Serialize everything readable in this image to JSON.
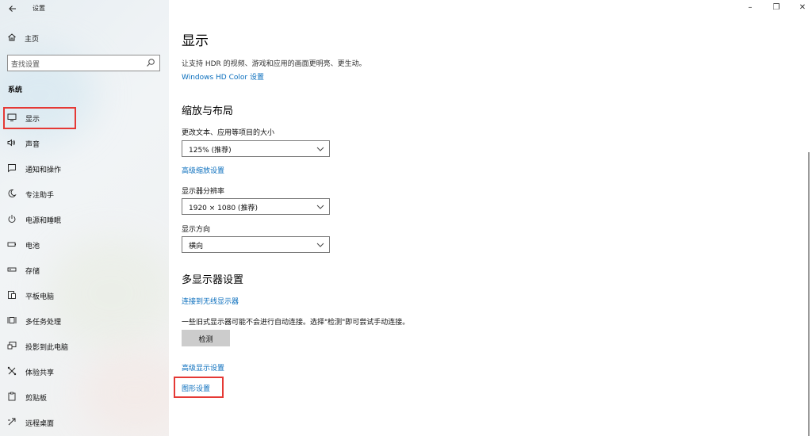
{
  "app": {
    "title": "设置"
  },
  "window_controls": {
    "minimize": "–",
    "restore": "❐",
    "close": "✕"
  },
  "sidebar": {
    "home_label": "主页",
    "search_placeholder": "查找设置",
    "section_label": "系统",
    "items": [
      {
        "label": "显示",
        "icon": "monitor-icon"
      },
      {
        "label": "声音",
        "icon": "speaker-icon"
      },
      {
        "label": "通知和操作",
        "icon": "notification-icon"
      },
      {
        "label": "专注助手",
        "icon": "moon-icon"
      },
      {
        "label": "电源和睡眠",
        "icon": "power-icon"
      },
      {
        "label": "电池",
        "icon": "battery-icon"
      },
      {
        "label": "存储",
        "icon": "storage-icon"
      },
      {
        "label": "平板电脑",
        "icon": "tablet-icon"
      },
      {
        "label": "多任务处理",
        "icon": "multitask-icon"
      },
      {
        "label": "投影到此电脑",
        "icon": "project-icon"
      },
      {
        "label": "体验共享",
        "icon": "share-icon"
      },
      {
        "label": "剪贴板",
        "icon": "clipboard-icon"
      },
      {
        "label": "远程桌面",
        "icon": "remote-desktop-icon"
      }
    ]
  },
  "main": {
    "title": "显示",
    "hdr_desc": "让支持 HDR 的视频、游戏和应用的画面更明亮、更生动。",
    "hdr_link": "Windows HD Color 设置",
    "scale_heading": "缩放与布局",
    "text_size_label": "更改文本、应用等项目的大小",
    "text_size_value": "125% (推荐)",
    "advanced_scale_link": "高级缩放设置",
    "resolution_label": "显示器分辨率",
    "resolution_value": "1920 × 1080 (推荐)",
    "orientation_label": "显示方向",
    "orientation_value": "横向",
    "multi_heading": "多显示器设置",
    "wireless_link": "连接到无线显示器",
    "detect_desc": "一些旧式显示器可能不会进行自动连接。选择\"检测\"即可尝试手动连接。",
    "detect_button": "检测",
    "advanced_display_link": "高级显示设置",
    "graphics_link": "图形设置"
  },
  "colors": {
    "accent_link": "#0a6ebd",
    "highlight_box": "#e53935",
    "button_bg": "#cccccc"
  }
}
